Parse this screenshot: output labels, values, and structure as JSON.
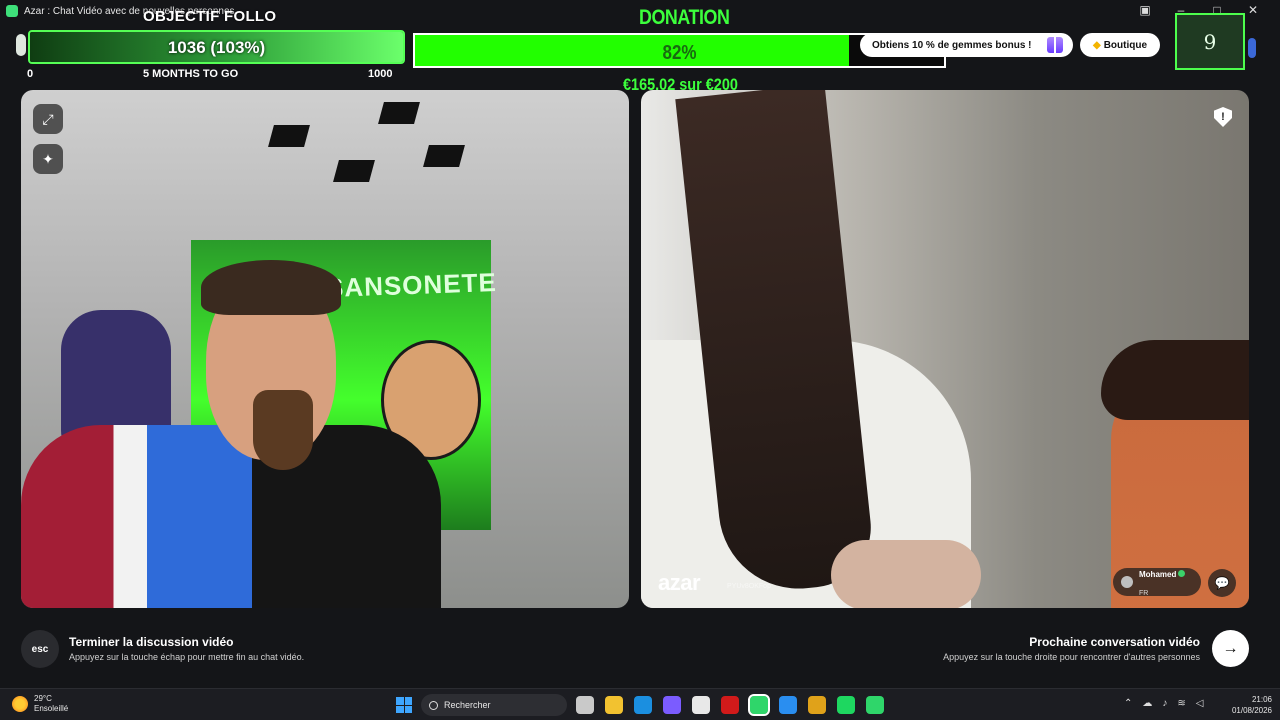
{
  "window": {
    "title": "Azar : Chat Vidéo avec de nouvelles personnes",
    "controls": [
      "camera-icon",
      "minimize-icon",
      "maximize-icon",
      "close-icon"
    ]
  },
  "objectif": {
    "title": "OBJECTIF FOLLO",
    "value": "1036 (103%)",
    "progress": 1.0,
    "min_label": "0",
    "sub_label": "5 MONTHS TO GO",
    "max_label": "1000",
    "accent": "#55ff55"
  },
  "donation": {
    "title": "DONATION",
    "percent_label": "82%",
    "progress": 0.82,
    "amount": "€165.02 sur €200",
    "accent": "#22ff00"
  },
  "azar_header": {
    "bonus_label": "Obtiens 10 % de gemmes bonus !",
    "shop_label": "Boutique",
    "gems_count": "9"
  },
  "video_left": {
    "mural_text": "SANSONETE",
    "controls": [
      "expand-icon",
      "magic-wand-icon"
    ]
  },
  "video_right": {
    "brand": "azar",
    "session_id": "PYUv8OKFop",
    "user": {
      "name": "Mohamed",
      "country": "FR"
    },
    "controls": [
      "report-shield-icon",
      "chat-bubble-icon"
    ]
  },
  "bottom": {
    "esc_label": "esc",
    "end_title": "Terminer la discussion vidéo",
    "end_sub": "Appuyez sur la touche échap pour mettre fin au chat vidéo.",
    "next_title": "Prochaine conversation vidéo",
    "next_sub": "Appuyez sur la touche droite pour rencontrer d'autres personnes",
    "next_icon": "arrow-right-icon"
  },
  "taskbar": {
    "weather_temp": "29°C",
    "weather_desc": "Ensoleillé",
    "search_placeholder": "Rechercher",
    "time": "21:06",
    "date": "01/08/2026",
    "app_colors": [
      "#c9c9c9",
      "#f2c230",
      "#1b8fe0",
      "#7b5cff",
      "#e8e8e8",
      "#d11a1a",
      "#2fd66a",
      "#2a8ef0",
      "#e0a21a",
      "#1ed760",
      "#2fd66a"
    ]
  }
}
